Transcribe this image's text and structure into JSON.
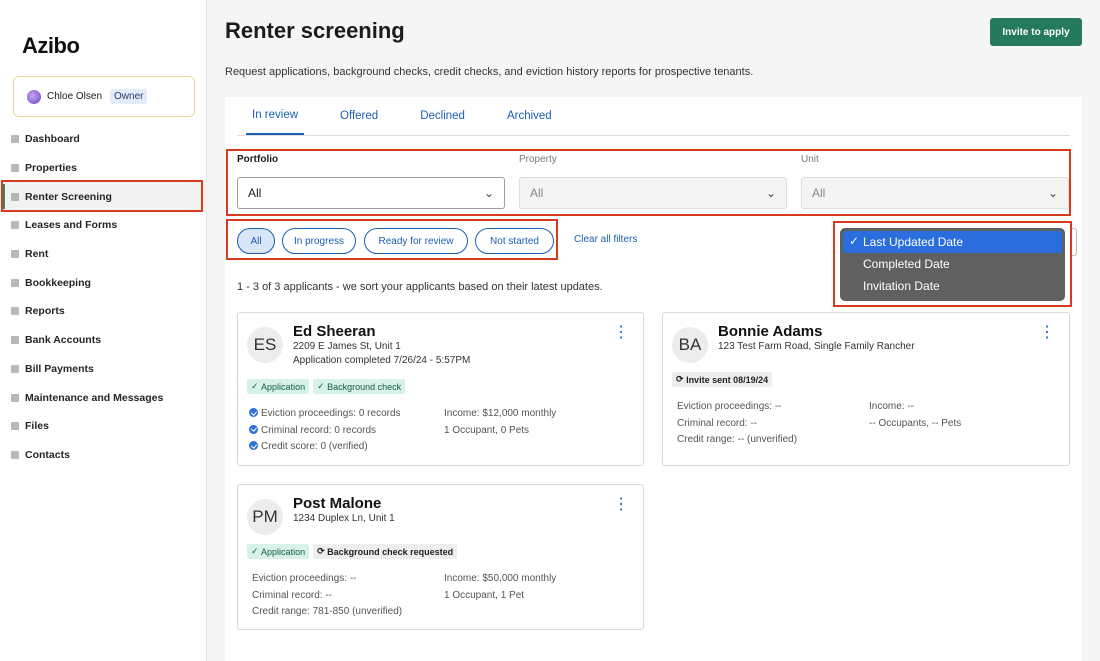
{
  "app": {
    "logo": "Azibo"
  },
  "user": {
    "name": "Chloe Olsen",
    "role": "Owner"
  },
  "nav": [
    {
      "label": "Dashboard",
      "icon": "home-icon"
    },
    {
      "label": "Properties",
      "icon": "building-icon"
    },
    {
      "label": "Renter Screening",
      "icon": "screening-icon",
      "active": true
    },
    {
      "label": "Leases and Forms",
      "icon": "document-icon"
    },
    {
      "label": "Rent",
      "icon": "rent-icon"
    },
    {
      "label": "Bookkeeping",
      "icon": "book-icon"
    },
    {
      "label": "Reports",
      "icon": "report-icon"
    },
    {
      "label": "Bank Accounts",
      "icon": "bank-icon"
    },
    {
      "label": "Bill Payments",
      "icon": "bill-icon"
    },
    {
      "label": "Maintenance and Messages",
      "icon": "wrench-icon"
    },
    {
      "label": "Files",
      "icon": "folder-icon"
    },
    {
      "label": "Contacts",
      "icon": "contacts-icon"
    }
  ],
  "page": {
    "title": "Renter screening",
    "subtitle": "Request applications, background checks, credit checks, and eviction history reports for prospective tenants.",
    "invite_button": "Invite to apply"
  },
  "tabs": [
    "In review",
    "Offered",
    "Declined",
    "Archived"
  ],
  "filters": {
    "portfolio": {
      "label": "Portfolio",
      "value": "All"
    },
    "property": {
      "label": "Property",
      "value": "All"
    },
    "unit": {
      "label": "Unit",
      "value": "All"
    }
  },
  "chips": [
    "All",
    "In progress",
    "Ready for review",
    "Not started"
  ],
  "clear_filters": "Clear all filters",
  "count_text": "1 - 3 of 3 applicants - we sort your applicants based on their latest updates.",
  "sort_options": [
    "Last Updated Date",
    "Completed Date",
    "Invitation Date"
  ],
  "applicants": [
    {
      "initials": "ES",
      "name": "Ed Sheeran",
      "address": "2209 E James St, Unit 1",
      "status_line": "Application completed 7/26/24 - 5:57PM",
      "tags": [
        "Application",
        "Background check"
      ],
      "left": [
        "Eviction proceedings: 0 records",
        "Criminal record: 0 records",
        "Credit score: 0 (verified)"
      ],
      "right": [
        "Income: $12,000 monthly",
        "1 Occupant, 0 Pets"
      ]
    },
    {
      "initials": "BA",
      "name": "Bonnie Adams",
      "address": "123 Test Farm Road, Single Family Rancher",
      "tags": [
        "Invite sent 08/19/24"
      ],
      "left": [
        "Eviction proceedings: --",
        "Criminal record: --",
        "Credit range: -- (unverified)"
      ],
      "right": [
        "Income: --",
        "-- Occupants, -- Pets"
      ]
    },
    {
      "initials": "PM",
      "name": "Post Malone",
      "address": "1234 Duplex Ln, Unit 1",
      "tags": [
        "Application",
        "Background check requested"
      ],
      "left": [
        "Eviction proceedings: --",
        "Criminal record: --",
        "Credit range: 781-850 (unverified)"
      ],
      "right": [
        "Income: $50,000 monthly",
        "1 Occupant, 1 Pet"
      ]
    }
  ],
  "colors": {
    "accent": "#237a5e",
    "link": "#1a5fb4",
    "highlight": "#d93a1d"
  }
}
